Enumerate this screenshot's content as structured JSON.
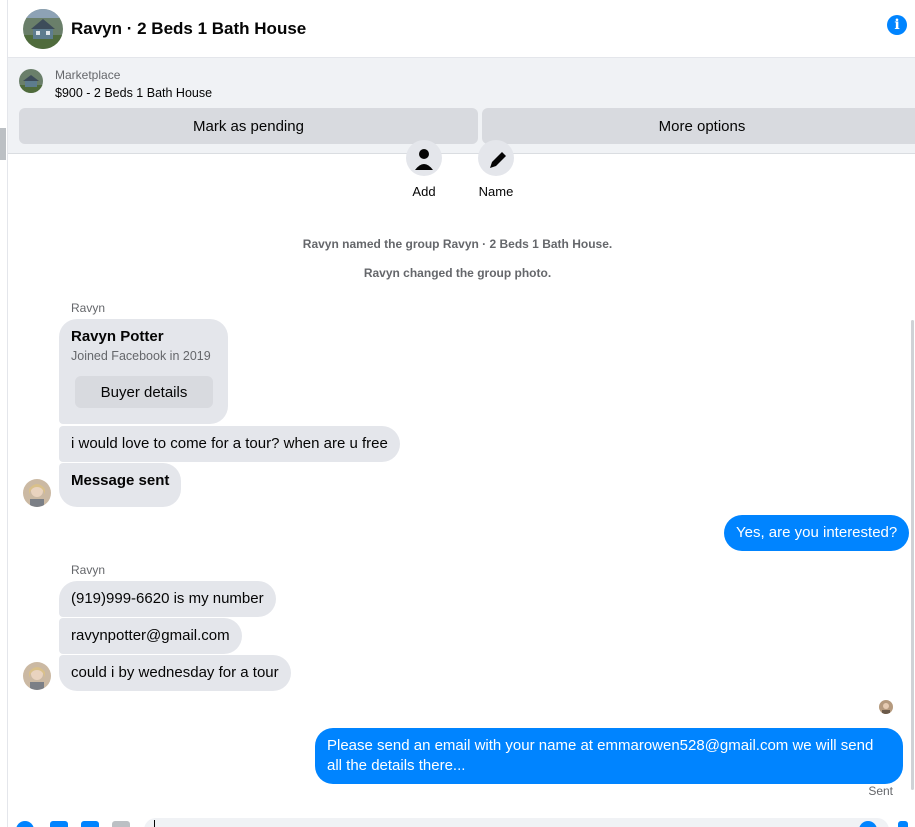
{
  "header": {
    "title": "Ravyn · 2 Beds 1 Bath House",
    "info_icon": "info-icon",
    "info_glyph": "i"
  },
  "marketplace": {
    "label": "Marketplace",
    "listing": "$900 - 2 Beds 1 Bath House",
    "mark_pending_label": "Mark as pending",
    "more_options_label": "More options"
  },
  "group_actions": [
    {
      "label": "Add",
      "icon": "add-person-icon"
    },
    {
      "label": "Name",
      "icon": "pencil-icon"
    }
  ],
  "system_messages": [
    "Ravyn named the group Ravyn · 2 Beds 1 Bath House.",
    "Ravyn changed the group photo."
  ],
  "conversation": {
    "sender_name_1": "Ravyn",
    "buyer_card": {
      "name": "Ravyn Potter",
      "joined": "Joined Facebook in 2019",
      "button_label": "Buyer details"
    },
    "msg_tour": "i would love to come for a tour? when are u free",
    "msg_sent_notice": "Message sent",
    "reply_interested": "Yes, are you interested?",
    "sender_name_2": "Ravyn",
    "msg_phone": "(919)999-6620 is my number",
    "msg_email": "ravynpotter@gmail.com",
    "msg_wednesday": "could i by wednesday for a tour",
    "reply_email": "Please send an email with your name at emmarowen528@gmail.com we will send all the details there...",
    "status": "Sent"
  },
  "colors": {
    "accent": "#0084ff",
    "bubble_gray": "#e4e6eb",
    "panel_bg": "#f0f2f5"
  }
}
